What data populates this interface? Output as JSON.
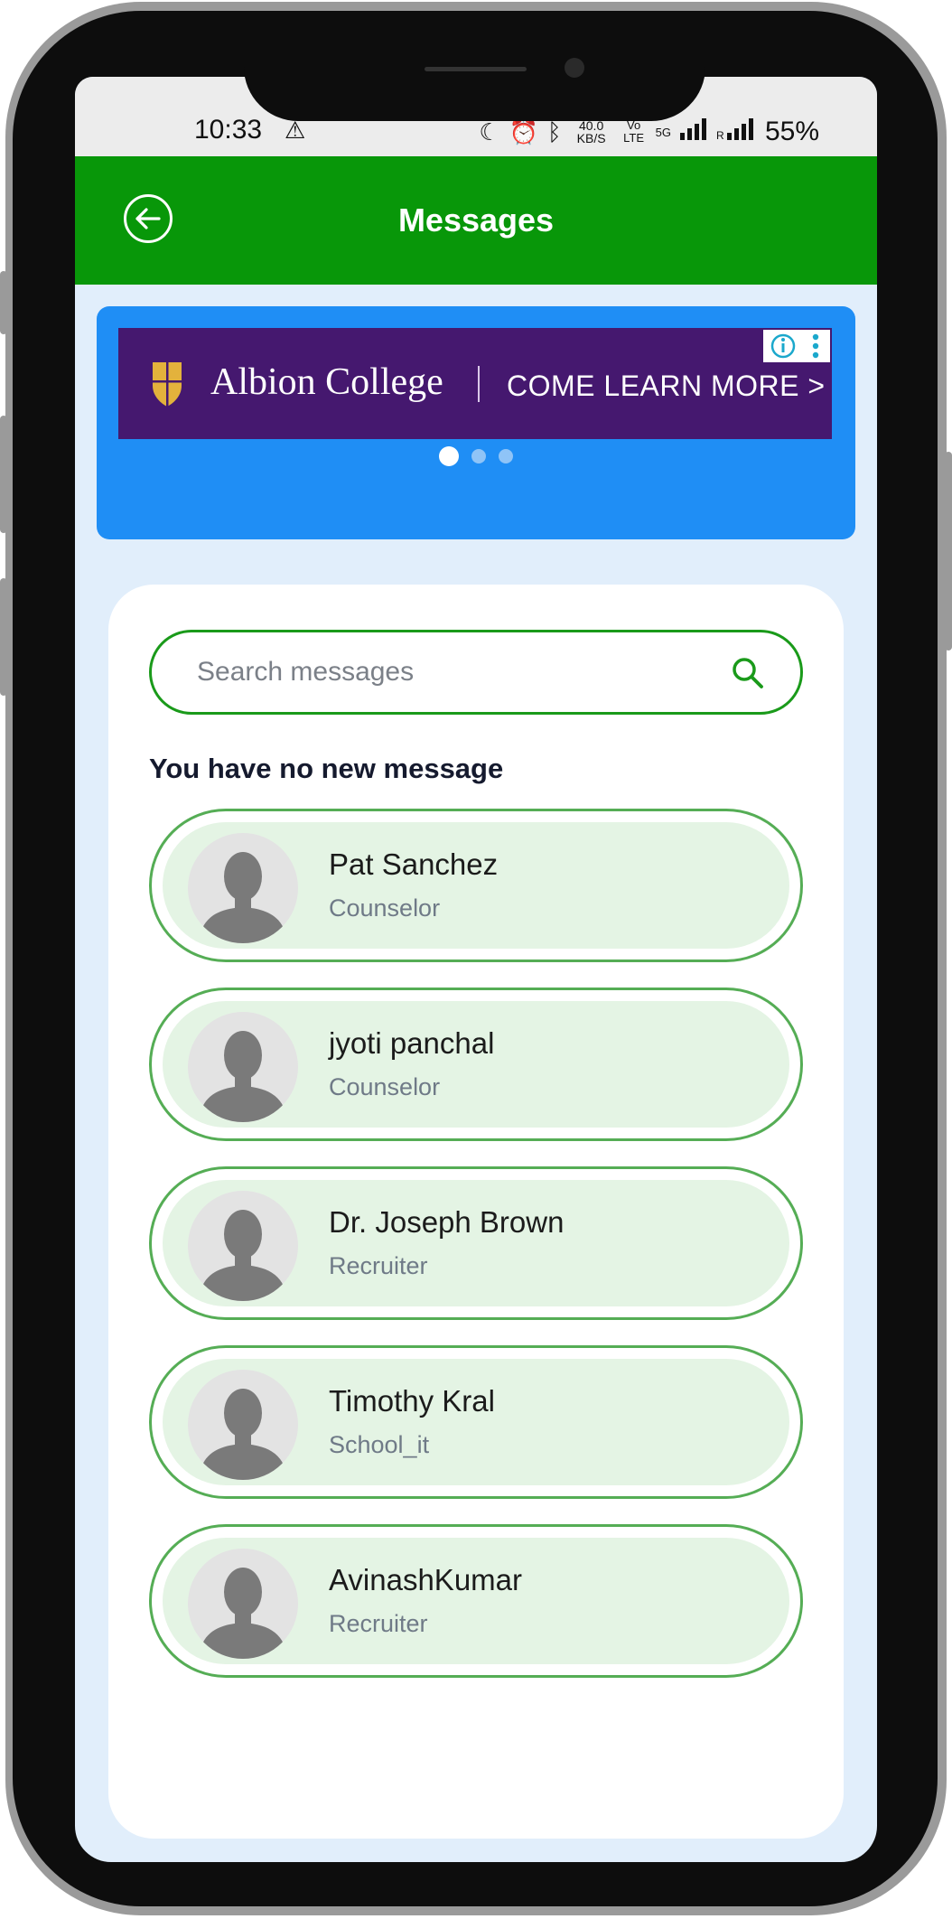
{
  "status_bar": {
    "time": "10:33",
    "alert_icon": "warning-triangle-icon",
    "net_speed": "40.0 KB/S",
    "network_labels": [
      "Vo LTE",
      "5G"
    ],
    "battery": "55%"
  },
  "header": {
    "back_icon": "arrow-left-circle-icon",
    "title": "Messages"
  },
  "banner": {
    "ad_name": "Albion College",
    "ad_cta": "COME LEARN MORE >",
    "dots_count": 3,
    "active_dot": 0
  },
  "search": {
    "placeholder": "Search messages",
    "icon": "search-icon"
  },
  "notice": "You have no new message",
  "contacts": [
    {
      "name": "Pat Sanchez",
      "role": "Counselor"
    },
    {
      "name": "jyoti panchal",
      "role": "Counselor"
    },
    {
      "name": "Dr. Joseph Brown",
      "role": "Recruiter"
    },
    {
      "name": "Timothy Kral",
      "role": "School_it"
    },
    {
      "name": "AvinashKumar",
      "role": "Recruiter"
    }
  ],
  "colors": {
    "header_green": "#089709",
    "banner_blue": "#1f8ef5",
    "ad_purple": "#45186f",
    "contact_bg": "#e4f4e4",
    "contact_border": "#55ad55",
    "screen_bg": "#e1eefb"
  }
}
